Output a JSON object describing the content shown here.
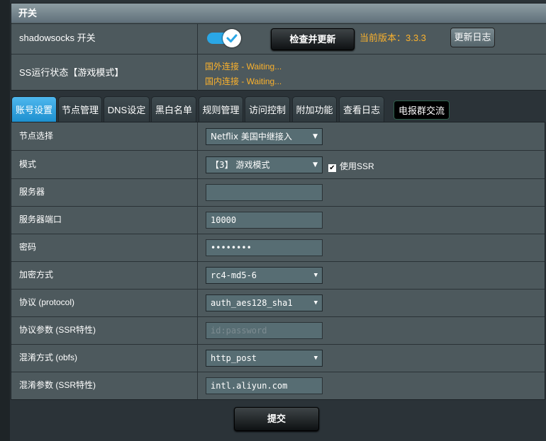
{
  "switch_panel": {
    "header": "开关",
    "ss_switch_label": "shadowsocks 开关",
    "toggle_on": true,
    "check_update_label": "检查并更新",
    "version_text": "当前版本：3.3.3",
    "changelog_label": "更新日志",
    "status_label": "SS运行状态【游戏模式】",
    "status_foreign": "国外连接 - Waiting...",
    "status_domestic": "国内连接 - Waiting..."
  },
  "tabs": [
    {
      "label": "账号设置",
      "active": true
    },
    {
      "label": "节点管理"
    },
    {
      "label": "DNS设定"
    },
    {
      "label": "黑白名单"
    },
    {
      "label": "规则管理"
    },
    {
      "label": "访问控制"
    },
    {
      "label": "附加功能"
    },
    {
      "label": "查看日志"
    },
    {
      "label": "电报群交流"
    }
  ],
  "form": {
    "node": {
      "label": "节点选择",
      "value": "Netflix 美国中继接入"
    },
    "mode": {
      "label": "模式",
      "value": "【3】 游戏模式",
      "ssr_label": "使用SSR",
      "ssr_checked": true
    },
    "server": {
      "label": "服务器",
      "value": ""
    },
    "port": {
      "label": "服务器端口",
      "value": "10000"
    },
    "password": {
      "label": "密码",
      "value": "••••••••"
    },
    "method": {
      "label": "加密方式",
      "value": "rc4-md5-6"
    },
    "protocol": {
      "label": "协议 (protocol)",
      "value": "auth_aes128_sha1"
    },
    "protocol_param": {
      "label": "协议参数 (SSR特性)",
      "placeholder": "id:password"
    },
    "obfs": {
      "label": "混淆方式 (obfs)",
      "value": "http_post"
    },
    "obfs_param": {
      "label": "混淆参数 (SSR特性)",
      "value": "intl.aliyun.com"
    }
  },
  "submit_label": "提交",
  "icons": {
    "check": "check-icon",
    "dropdown": "dropdown-arrow-icon"
  }
}
